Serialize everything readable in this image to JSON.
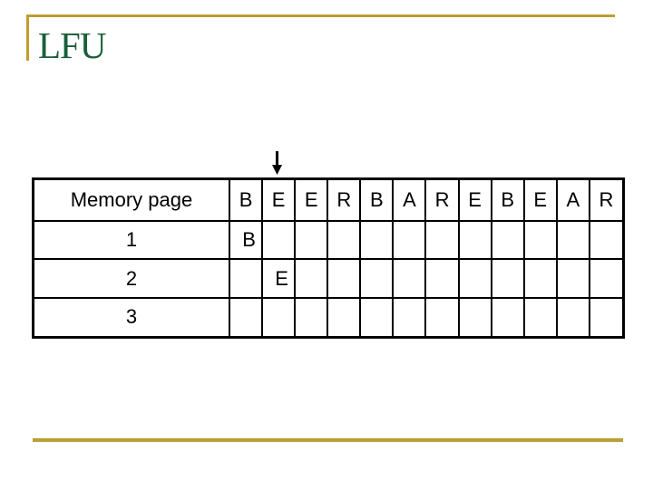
{
  "slide": {
    "title": "LFU",
    "accent_color": "#C09C2C",
    "title_color": "#1B5E3B",
    "frame_entry_color": "#B36BD4"
  },
  "pointer": {
    "icon": "down-arrow-icon",
    "points_to_reference_index": 1
  },
  "table": {
    "header_label": "Memory page",
    "reference_string": [
      "B",
      "E",
      "E",
      "R",
      "B",
      "A",
      "R",
      "E",
      "B",
      "E",
      "A",
      "R"
    ],
    "frames": [
      {
        "label": "1",
        "cells": [
          "B",
          "",
          "",
          "",
          "",
          "",
          "",
          "",
          "",
          "",
          "",
          ""
        ]
      },
      {
        "label": "2",
        "cells": [
          "",
          "E",
          "",
          "",
          "",
          "",
          "",
          "",
          "",
          "",
          "",
          ""
        ]
      },
      {
        "label": "3",
        "cells": [
          "",
          "",
          "",
          "",
          "",
          "",
          "",
          "",
          "",
          "",
          "",
          ""
        ]
      }
    ]
  }
}
